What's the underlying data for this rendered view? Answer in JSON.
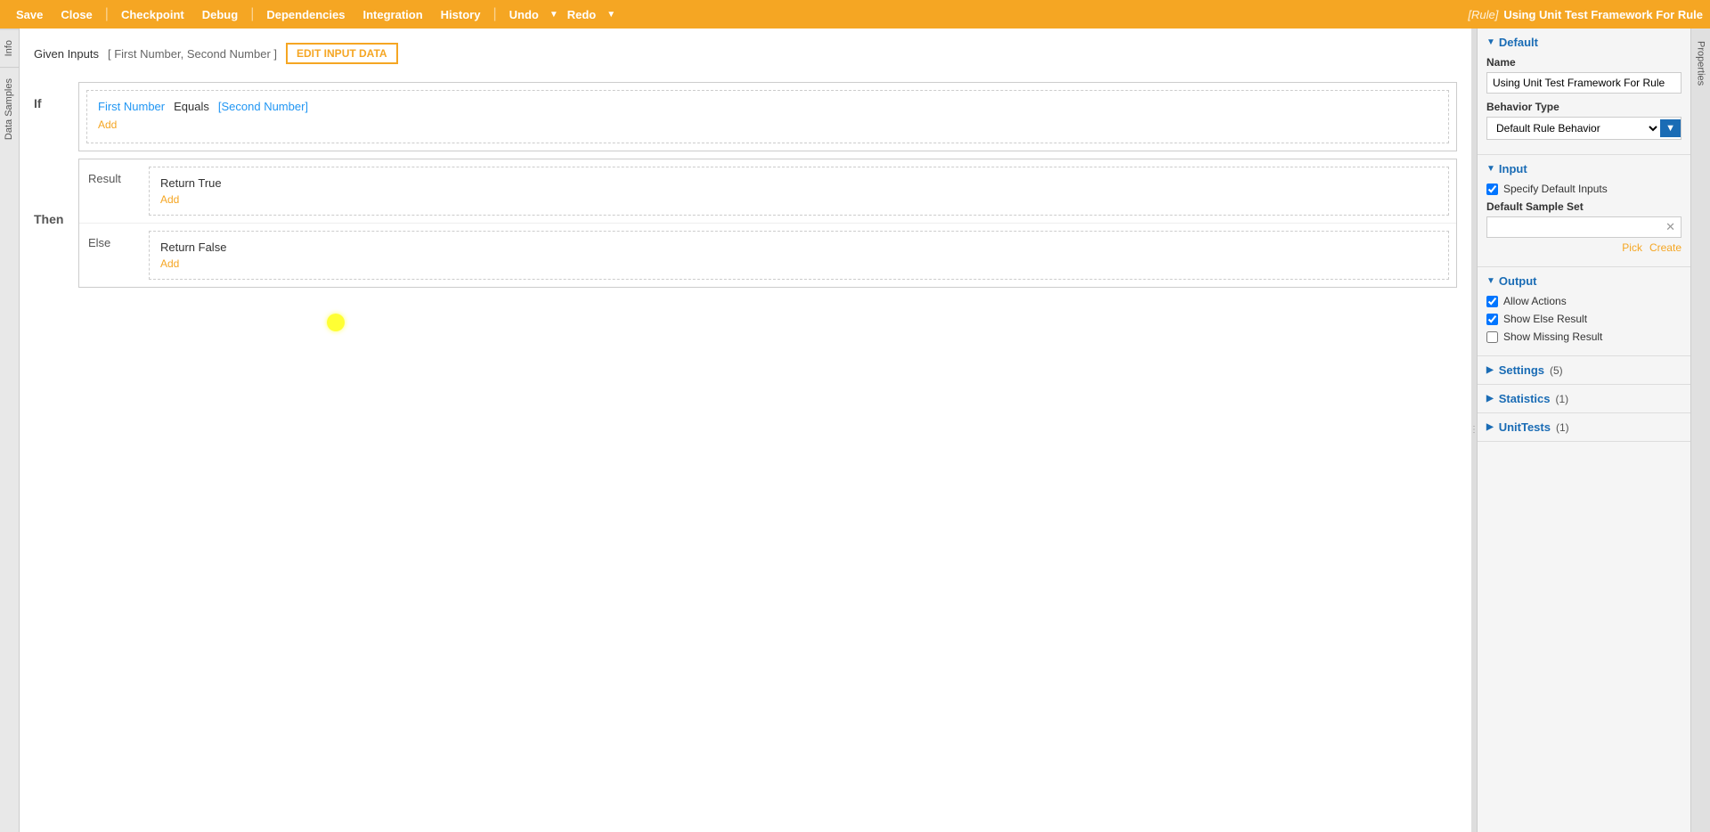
{
  "toolbar": {
    "save_label": "Save",
    "close_label": "Close",
    "checkpoint_label": "Checkpoint",
    "debug_label": "Debug",
    "dependencies_label": "Dependencies",
    "integration_label": "Integration",
    "history_label": "History",
    "undo_label": "Undo",
    "redo_label": "Redo",
    "rule_tag": "[Rule]",
    "rule_name": "Using Unit Test Framework For Rule"
  },
  "left_panel": {
    "info_tab": "Info",
    "data_samples_tab": "Data Samples"
  },
  "given_inputs": {
    "label": "Given Inputs",
    "values": "[ First Number, Second Number ]",
    "edit_button": "EDIT INPUT DATA"
  },
  "rule": {
    "if_label": "If",
    "then_label": "Then",
    "condition": {
      "field": "First Number",
      "operator": "Equals",
      "value": "[Second Number]"
    },
    "add_condition": "Add",
    "result_label": "Result",
    "result_value": "Return True",
    "add_result": "Add",
    "else_label": "Else",
    "else_value": "Return False",
    "add_else": "Add"
  },
  "properties": {
    "tab_label": "Properties",
    "default_section": {
      "title": "Default",
      "name_label": "Name",
      "name_value": "Using Unit Test Framework For Rule",
      "behavior_type_label": "Behavior Type",
      "behavior_type_value": "Default Rule Behavior"
    },
    "input_section": {
      "title": "Input",
      "specify_default_inputs_label": "Specify Default Inputs",
      "specify_default_inputs_checked": true,
      "default_sample_set_label": "Default Sample Set",
      "default_sample_set_value": "",
      "pick_label": "Pick",
      "create_label": "Create"
    },
    "output_section": {
      "title": "Output",
      "allow_actions_label": "Allow Actions",
      "allow_actions_checked": true,
      "show_else_result_label": "Show Else Result",
      "show_else_result_checked": true,
      "show_missing_result_label": "Show Missing Result",
      "show_missing_result_checked": false
    },
    "settings_section": {
      "title": "Settings",
      "count": "(5)"
    },
    "statistics_section": {
      "title": "Statistics",
      "count": "(1)"
    },
    "unit_tests_section": {
      "title": "UnitTests",
      "count": "(1)"
    }
  }
}
